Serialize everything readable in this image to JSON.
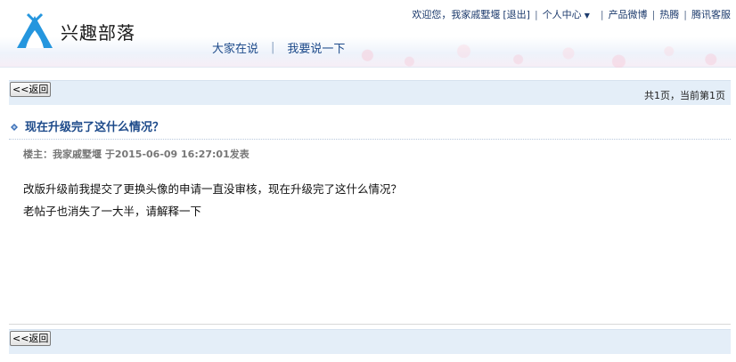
{
  "logo": {
    "text": "兴趣部落",
    "color": "#2596de"
  },
  "main_nav": [
    {
      "label": "大家在说"
    },
    {
      "label": "我要说一下"
    }
  ],
  "top_links": {
    "greeting": "欢迎您，我家戚墅堰",
    "logout": "[退出]",
    "personal_center": "个人中心",
    "product_weibo": "产品微博",
    "hot": "热腾",
    "service": "腾讯客服",
    "separator": "|"
  },
  "nav_bar": {
    "back_label": "<<返回",
    "page_info": "共1页，当前第1页"
  },
  "topic": {
    "title": "现在升级完了这什么情况？",
    "author_line": "楼主：我家戚墅堰 于2015-06-09 16:27:01发表",
    "body_lines": [
      "改版升级前我提交了更换头像的申请一直没审核，现在升级完了这什么情况？",
      "老帖子也消失了一大半，请解释一下"
    ]
  },
  "colors": {
    "link": "#1d4a8a",
    "bar_bg": "#e4eef8",
    "bullet": "#3b6fb6"
  }
}
